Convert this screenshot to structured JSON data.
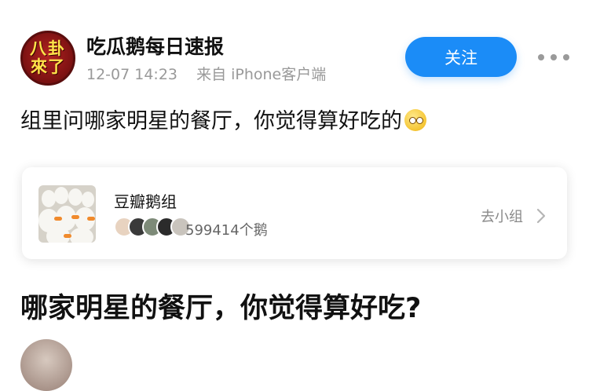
{
  "post": {
    "author_avatar_text": [
      "八卦",
      "來了"
    ],
    "author_name": "吃瓜鹅每日速报",
    "timestamp": "12-07 14:23",
    "source": "来自 iPhone客户端",
    "follow_label": "关注",
    "more_icon": "more-horizontal-icon",
    "text": "组里问哪家明星的餐厅，你觉得算好吃的",
    "emoji": "thinking-face-emoji"
  },
  "group_card": {
    "name": "豆瓣鹅组",
    "member_count": "599414个鹅",
    "go_label": "去小组",
    "chevron_icon": "chevron-right-icon"
  },
  "topic": {
    "title": "哪家明星的餐厅，你觉得算好吃?"
  },
  "colors": {
    "accent": "#1b8cf7",
    "meta_text": "#999999",
    "avatar_red": "#b32222",
    "avatar_yellow": "#ffe34a"
  }
}
